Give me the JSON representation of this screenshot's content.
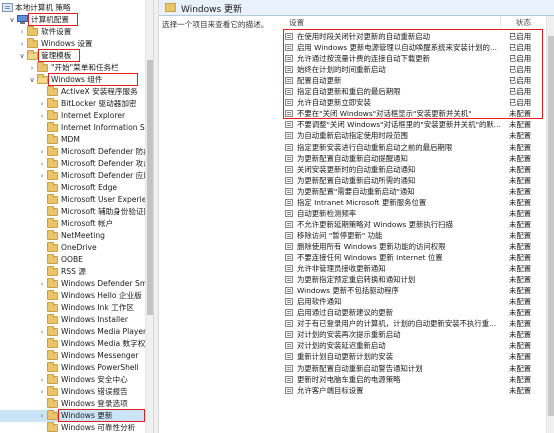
{
  "tree": {
    "items": [
      {
        "label": "本地计算机 策略",
        "level": 0,
        "icon": "policy-icon",
        "twist": ""
      },
      {
        "label": "计算机配置",
        "level": 1,
        "icon": "computer-icon",
        "twist": "v",
        "boxed": true
      },
      {
        "label": "软件设置",
        "level": 2,
        "icon": "folder-icon",
        "twist": ">"
      },
      {
        "label": "Windows 设置",
        "level": 2,
        "icon": "folder-icon",
        "twist": ">"
      },
      {
        "label": "管理模板",
        "level": 2,
        "icon": "folder-icon",
        "twist": "v",
        "boxed": true
      },
      {
        "label": "\"开始\"菜单和任务栏",
        "level": 3,
        "icon": "folder-icon",
        "twist": ">"
      },
      {
        "label": "Windows 组件",
        "level": 3,
        "icon": "folder-icon",
        "twist": "v",
        "boxed": true
      },
      {
        "label": "ActiveX 安装程序服务",
        "level": 4,
        "icon": "folder-icon",
        "twist": ""
      },
      {
        "label": "BitLocker 驱动器加密",
        "level": 4,
        "icon": "folder-icon",
        "twist": ">"
      },
      {
        "label": "Internet Explorer",
        "level": 4,
        "icon": "folder-icon",
        "twist": ">"
      },
      {
        "label": "Internet Information Ser",
        "level": 4,
        "icon": "folder-icon",
        "twist": ""
      },
      {
        "label": "MDM",
        "level": 4,
        "icon": "folder-icon",
        "twist": ""
      },
      {
        "label": "Microsoft Defender 防病",
        "level": 4,
        "icon": "folder-icon",
        "twist": ">"
      },
      {
        "label": "Microsoft Defender 攻击",
        "level": 4,
        "icon": "folder-icon",
        "twist": ">"
      },
      {
        "label": "Microsoft Defender 应用",
        "level": 4,
        "icon": "folder-icon",
        "twist": ">"
      },
      {
        "label": "Microsoft Edge",
        "level": 4,
        "icon": "folder-icon",
        "twist": ""
      },
      {
        "label": "Microsoft User Experien",
        "level": 4,
        "icon": "folder-icon",
        "twist": ""
      },
      {
        "label": "Microsoft 辅助身份验证因",
        "level": 4,
        "icon": "folder-icon",
        "twist": ""
      },
      {
        "label": "Microsoft 帐户",
        "level": 4,
        "icon": "folder-icon",
        "twist": ""
      },
      {
        "label": "NetMeeting",
        "level": 4,
        "icon": "folder-icon",
        "twist": ""
      },
      {
        "label": "OneDrive",
        "level": 4,
        "icon": "folder-icon",
        "twist": ""
      },
      {
        "label": "OOBE",
        "level": 4,
        "icon": "folder-icon",
        "twist": ""
      },
      {
        "label": "RSS 源",
        "level": 4,
        "icon": "folder-icon",
        "twist": ""
      },
      {
        "label": "Windows Defender Sma",
        "level": 4,
        "icon": "folder-icon",
        "twist": ">"
      },
      {
        "label": "Windows Hello 企业版",
        "level": 4,
        "icon": "folder-icon",
        "twist": ""
      },
      {
        "label": "Windows Ink 工作区",
        "level": 4,
        "icon": "folder-icon",
        "twist": ""
      },
      {
        "label": "Windows Installer",
        "level": 4,
        "icon": "folder-icon",
        "twist": ""
      },
      {
        "label": "Windows Media Player",
        "level": 4,
        "icon": "folder-icon",
        "twist": ">"
      },
      {
        "label": "Windows Media 数字权限",
        "level": 4,
        "icon": "folder-icon",
        "twist": ""
      },
      {
        "label": "Windows Messenger",
        "level": 4,
        "icon": "folder-icon",
        "twist": ""
      },
      {
        "label": "Windows PowerShell",
        "level": 4,
        "icon": "folder-icon",
        "twist": ""
      },
      {
        "label": "Windows 安全中心",
        "level": 4,
        "icon": "folder-icon",
        "twist": ">"
      },
      {
        "label": "Windows 错误报告",
        "level": 4,
        "icon": "folder-icon",
        "twist": ">"
      },
      {
        "label": "Windows 登录选项",
        "level": 4,
        "icon": "folder-icon",
        "twist": ""
      },
      {
        "label": "Windows 更新",
        "level": 4,
        "icon": "folder-icon",
        "twist": ">",
        "boxed": true,
        "selected": true
      },
      {
        "label": "Windows 可靠性分析",
        "level": 4,
        "icon": "folder-icon",
        "twist": ""
      }
    ]
  },
  "header": {
    "title": "Windows 更新"
  },
  "description": {
    "text": "选择一个项目来查看它的描述。"
  },
  "list": {
    "col_setting": "设置",
    "col_state": "状态",
    "rows": [
      {
        "name": "在使用时段关闭针对更新的自动重新启动",
        "state": "已启用"
      },
      {
        "name": "启用 Windows 更新电源管理以自动唤醒系统来安装计划的...",
        "state": "已启用"
      },
      {
        "name": "允许通过按流量计费的连接自动下载更新",
        "state": "已启用"
      },
      {
        "name": "始终在计划的时间重新启动",
        "state": "已启用"
      },
      {
        "name": "配置自动更新",
        "state": "已启用"
      },
      {
        "name": "指定自动更新和重启的最后期限",
        "state": "已启用"
      },
      {
        "name": "允许自动更新立即安装",
        "state": "已启用"
      },
      {
        "name": "不要在\"关闭 Windows\"对话框显示\"安装更新并关机\"",
        "state": "未配置"
      },
      {
        "name": "不要调整\"关闭 Windows\"对话框里的\"安装更新并关机\"的默...",
        "state": "未配置"
      },
      {
        "name": "为自动重新启动指定使用时段范围",
        "state": "未配置"
      },
      {
        "name": "指定更新安装进行自动重新启动之前的最后期限",
        "state": "未配置"
      },
      {
        "name": "为更新配置自动重新启动提醒通知",
        "state": "未配置"
      },
      {
        "name": "关闭安装更新时的自动重新启动通知",
        "state": "未配置"
      },
      {
        "name": "为更新配置自动重新启动所需的通知",
        "state": "未配置"
      },
      {
        "name": "为更新配置\"需要自动重新启动\"通知",
        "state": "未配置"
      },
      {
        "name": "指定 Intranet Microsoft 更新服务位置",
        "state": "未配置"
      },
      {
        "name": "自动更新检测频率",
        "state": "未配置"
      },
      {
        "name": "不允许更新延期策略对 Windows 更新执行扫描",
        "state": "未配置"
      },
      {
        "name": "移除访问 \"暂停更新\" 功能",
        "state": "未配置"
      },
      {
        "name": "删除使用所有 Windows 更新功能的访问权限",
        "state": "未配置"
      },
      {
        "name": "不要连接任何 Windows 更新 Internet 位置",
        "state": "未配置"
      },
      {
        "name": "允许非管理员接收更新通知",
        "state": "未配置"
      },
      {
        "name": "为更新指定预定重启转换和通知计划",
        "state": "未配置"
      },
      {
        "name": "Windows 更新不包括驱动程序",
        "state": "未配置"
      },
      {
        "name": "启用软件通知",
        "state": "未配置"
      },
      {
        "name": "启用通过自动更新建议的更新",
        "state": "未配置"
      },
      {
        "name": "对于有已登录用户的计算机，计划的自动更新安装不执行重...",
        "state": "未配置"
      },
      {
        "name": "对计划的安装再次提示重新启动",
        "state": "未配置"
      },
      {
        "name": "对计划的安装延迟重新启动",
        "state": "未配置"
      },
      {
        "name": "重新计划自动更新计划的安装",
        "state": "未配置"
      },
      {
        "name": "为更新配置自动重新启动警告通知计划",
        "state": "未配置"
      },
      {
        "name": "更新时对电脑车重启的电源策略",
        "state": "未配置"
      },
      {
        "name": "允许客户端目标设置",
        "state": "未配置"
      }
    ]
  }
}
